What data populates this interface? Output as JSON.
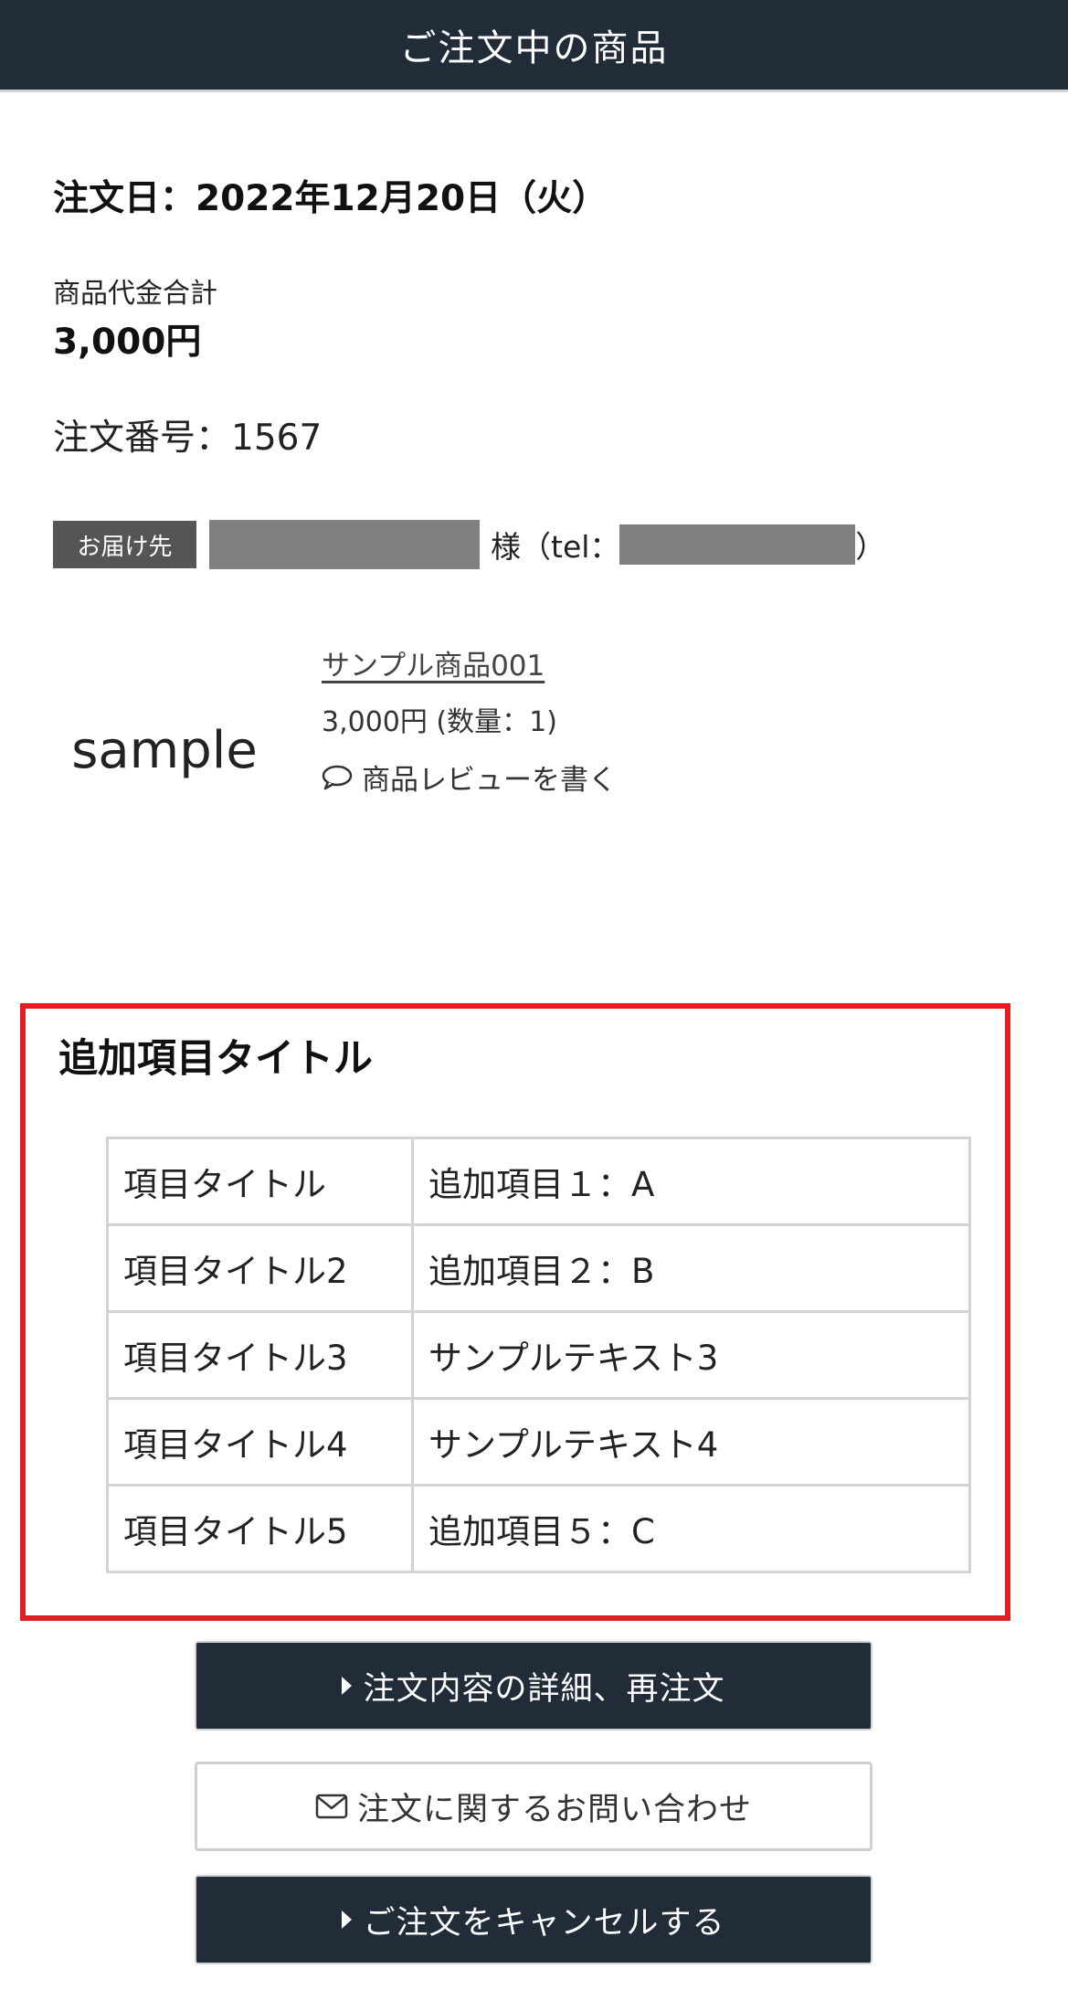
{
  "header": {
    "title": "ご注文中の商品"
  },
  "order": {
    "date": "注文日：2022年12月20日（火）",
    "total_label": "商品代金合計",
    "total_value": "3,000円",
    "number": "注文番号：1567"
  },
  "delivery": {
    "badge": "お届け先",
    "sama_tel": "様（tel：",
    "close": "）"
  },
  "product": {
    "image_text": "sample",
    "name": "サンプル商品001",
    "price": "3,000円 (数量：1)",
    "review": "商品レビューを書く"
  },
  "extra": {
    "title": "追加項目タイトル",
    "rows": [
      {
        "key": "項目タイトル",
        "value": "追加項目１：A"
      },
      {
        "key": "項目タイトル2",
        "value": "追加項目２：B"
      },
      {
        "key": "項目タイトル3",
        "value": "サンプルテキスト3"
      },
      {
        "key": "項目タイトル4",
        "value": "サンプルテキスト4"
      },
      {
        "key": "項目タイトル5",
        "value": "追加項目５：C"
      }
    ]
  },
  "buttons": {
    "detail": "注文内容の詳細、再注文",
    "inquiry": "注文に関するお問い合わせ",
    "cancel": "ご注文をキャンセルする"
  },
  "colors": {
    "header_bg": "#222b38",
    "highlight_border": "#e31e25",
    "badge_bg": "#555555",
    "redaction": "#808080"
  }
}
